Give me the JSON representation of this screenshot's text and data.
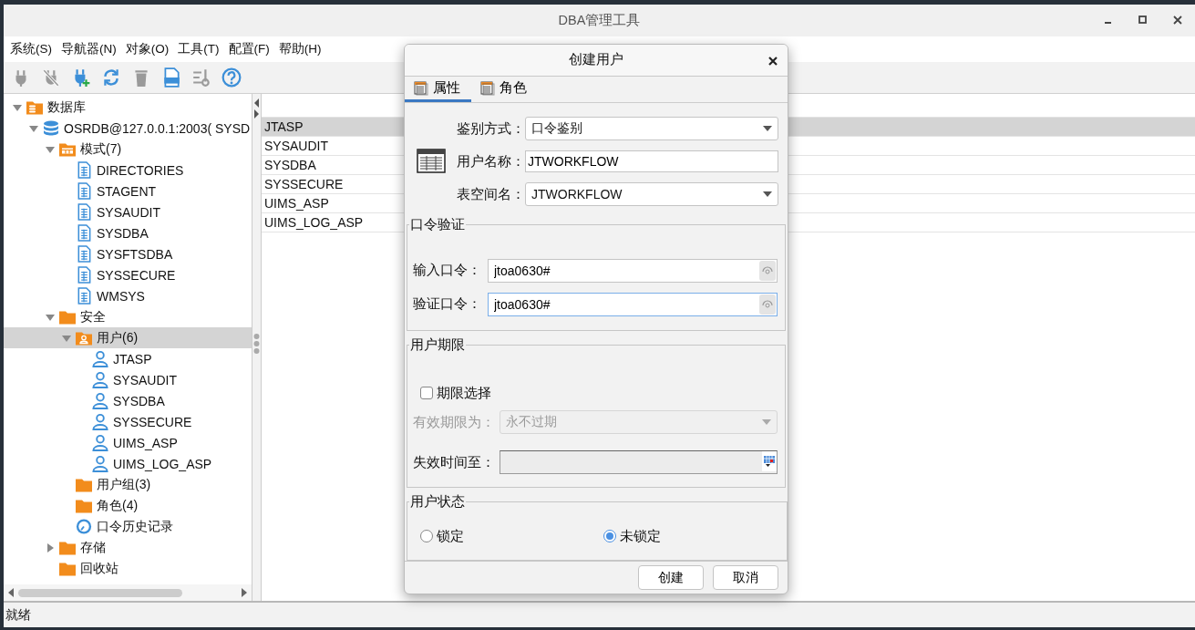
{
  "window": {
    "title": "DBA管理工具"
  },
  "menu": [
    "系统(S)",
    "导航器(N)",
    "对象(O)",
    "工具(T)",
    "配置(F)",
    "帮助(H)"
  ],
  "toolbar": [
    {
      "kind": "plug",
      "disabled": true
    },
    {
      "kind": "unplug",
      "disabled": true
    },
    {
      "kind": "plug-add",
      "disabled": false
    },
    {
      "kind": "refresh",
      "disabled": false
    },
    {
      "kind": "trash",
      "disabled": true
    },
    {
      "kind": "obj-file",
      "disabled": false
    },
    {
      "kind": "sort",
      "disabled": true
    },
    {
      "kind": "help",
      "disabled": false
    }
  ],
  "tree": [
    {
      "label": "数据库",
      "kind": "db-folder",
      "expanded": true,
      "selected": false,
      "children": [
        {
          "label": "OSRDB@127.0.0.1:2003( SYSD",
          "kind": "database",
          "expanded": true,
          "selected": false,
          "children": [
            {
              "label": "模式(7)",
              "kind": "schema",
              "expanded": true,
              "selected": false,
              "children": [
                {
                  "label": "DIRECTORIES",
                  "kind": "table",
                  "selected": false
                },
                {
                  "label": "STAGENT",
                  "kind": "table",
                  "selected": false
                },
                {
                  "label": "SYSAUDIT",
                  "kind": "table",
                  "selected": false
                },
                {
                  "label": "SYSDBA",
                  "kind": "table",
                  "selected": false
                },
                {
                  "label": "SYSFTSDBA",
                  "kind": "table",
                  "selected": false
                },
                {
                  "label": "SYSSECURE",
                  "kind": "table",
                  "selected": false
                },
                {
                  "label": "WMSYS",
                  "kind": "table",
                  "selected": false
                }
              ]
            },
            {
              "label": "安全",
              "kind": "folder",
              "expanded": true,
              "selected": false,
              "children": [
                {
                  "label": "用户(6)",
                  "kind": "user-folder",
                  "expanded": true,
                  "selected": true,
                  "children": [
                    {
                      "label": "JTASP",
                      "kind": "user",
                      "selected": false
                    },
                    {
                      "label": "SYSAUDIT",
                      "kind": "user",
                      "selected": false
                    },
                    {
                      "label": "SYSDBA",
                      "kind": "user",
                      "selected": false
                    },
                    {
                      "label": "SYSSECURE",
                      "kind": "user",
                      "selected": false
                    },
                    {
                      "label": "UIMS_ASP",
                      "kind": "user",
                      "selected": false
                    },
                    {
                      "label": "UIMS_LOG_ASP",
                      "kind": "user",
                      "selected": false
                    }
                  ]
                },
                {
                  "label": "用户组(3)",
                  "kind": "folder",
                  "selected": false
                },
                {
                  "label": "角色(4)",
                  "kind": "folder",
                  "selected": false
                },
                {
                  "label": "口令历史记录",
                  "kind": "history",
                  "selected": false
                }
              ]
            },
            {
              "label": "存储",
              "kind": "folder",
              "expanded": false,
              "selected": false
            },
            {
              "label": "回收站",
              "kind": "folder",
              "selected": false
            }
          ]
        }
      ]
    }
  ],
  "list": {
    "rows": [
      {
        "text": "JTASP",
        "selected": true
      },
      {
        "text": "SYSAUDIT",
        "selected": false
      },
      {
        "text": "SYSDBA",
        "selected": false
      },
      {
        "text": "SYSSECURE",
        "selected": false
      },
      {
        "text": "UIMS_ASP",
        "selected": false
      },
      {
        "text": "UIMS_LOG_ASP",
        "selected": false
      }
    ]
  },
  "status_bar": "就绪",
  "dialog": {
    "title": "创建用户",
    "tabs": [
      {
        "label": "属性",
        "selected": true
      },
      {
        "label": "角色",
        "selected": false
      }
    ],
    "fields": [
      {
        "kind": "dropdown",
        "label": "鉴别方式：",
        "value": "口令鉴别"
      },
      {
        "kind": "text",
        "label": "用户名称：",
        "value": "JTWORKFLOW"
      },
      {
        "kind": "dropdown",
        "label": "表空间名：",
        "value": "JTWORKFLOW"
      }
    ],
    "password_group": {
      "title": "口令验证",
      "fields": [
        {
          "label": "输入口令：",
          "value": "jtoa0630#",
          "focused": false
        },
        {
          "label": "验证口令：",
          "value": "jtoa0630#",
          "focused": true
        }
      ]
    },
    "expiry_group": {
      "title": "用户期限",
      "checkbox": {
        "label": "期限选择",
        "checked": false
      },
      "validity": {
        "label": "有效期限为：",
        "value": "永不过期",
        "disabled": true
      },
      "expire_at": {
        "label": "失效时间至："
      }
    },
    "status_group": {
      "title": "用户状态",
      "options": [
        {
          "label": "锁定",
          "selected": false
        },
        {
          "label": "未锁定",
          "selected": true
        }
      ]
    },
    "buttons": [
      "创建",
      "取消"
    ]
  }
}
